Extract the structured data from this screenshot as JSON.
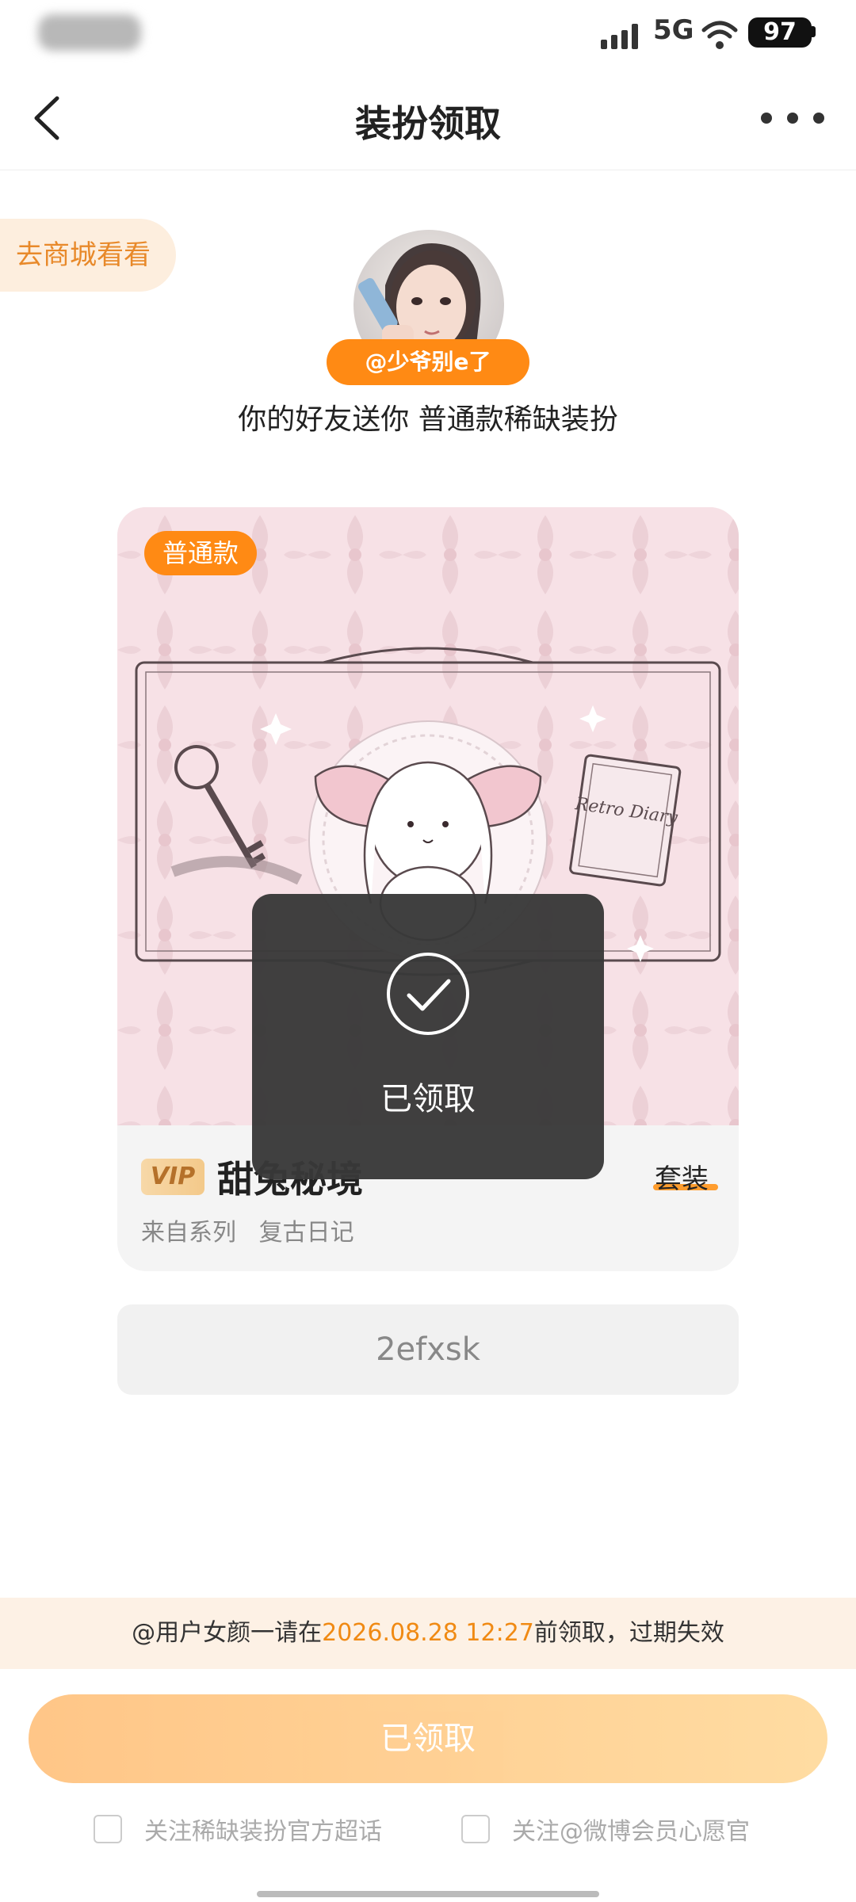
{
  "status_bar": {
    "network": "5G",
    "battery": "97"
  },
  "nav": {
    "title": "装扮领取"
  },
  "shop_link": "去商城看看",
  "sender": {
    "name": "@少爷别e了",
    "message": "你的好友送你 普通款稀缺装扮"
  },
  "card": {
    "tier_badge": "普通款",
    "vip_label": "VIP",
    "item_name": "甜兔秘境",
    "item_type": "套装",
    "series_label": "来自系列",
    "series_name": "复古日记",
    "artwork_text": "Retro Diary"
  },
  "code": "2efxsk",
  "toast": {
    "text": "已领取"
  },
  "notice": {
    "prefix": "@用户女颜一请在",
    "deadline": "2026.08.28 12:27",
    "suffix": "前领取，过期失效"
  },
  "claim_button": {
    "label": "已领取"
  },
  "follow_options": [
    {
      "label": "关注稀缺装扮官方超话"
    },
    {
      "label": "关注@微博会员心愿官"
    }
  ],
  "colors": {
    "accent": "#ff8a14",
    "notice_highlight": "#f08a14",
    "button_gradient_start": "#ffc17d",
    "button_gradient_end": "#ffd99a"
  }
}
